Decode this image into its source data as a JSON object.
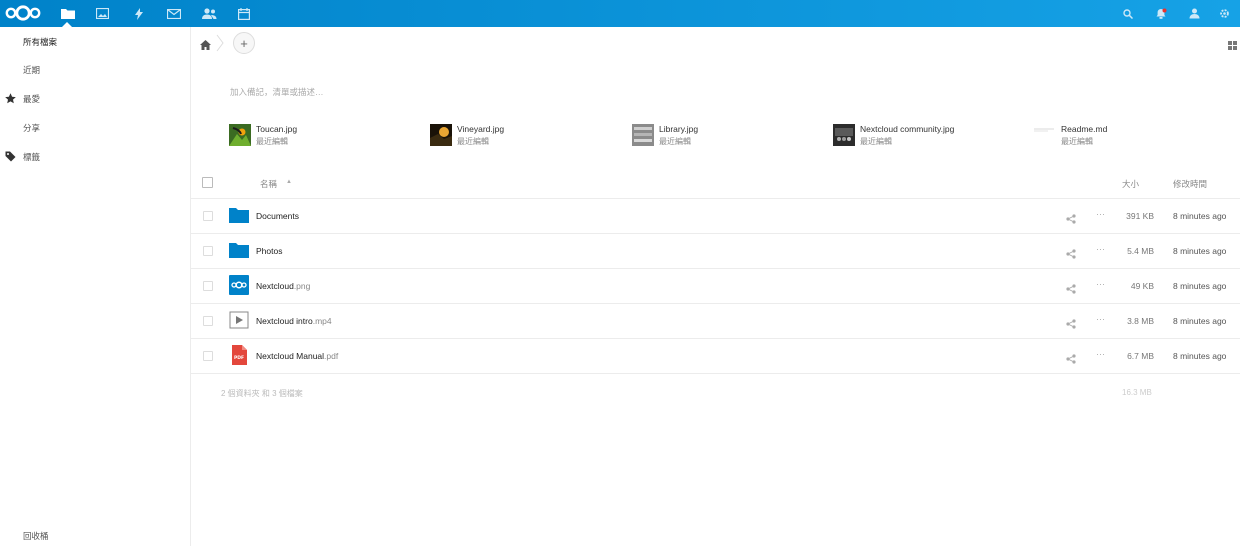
{
  "topbar": {
    "accent": "#0082c9",
    "apps": [
      {
        "name": "files-icon"
      },
      {
        "name": "photos-icon"
      },
      {
        "name": "activity-icon"
      },
      {
        "name": "mail-icon"
      },
      {
        "name": "contacts-icon"
      },
      {
        "name": "calendar-icon"
      }
    ],
    "right_icons": [
      {
        "name": "search-icon"
      },
      {
        "name": "notifications-icon"
      },
      {
        "name": "contacts-menu-icon"
      },
      {
        "name": "settings-icon"
      }
    ]
  },
  "sidebar": {
    "items": [
      {
        "label": "所有檔案"
      },
      {
        "label": "近期"
      },
      {
        "label": "最愛"
      },
      {
        "label": "分享"
      },
      {
        "label": "標籤"
      }
    ],
    "trash_label": "回收桶"
  },
  "toolbar": {
    "add_label": "+"
  },
  "note": {
    "placeholder": "加入備記，清單或描述…"
  },
  "recent_files": [
    {
      "name": "Toucan.jpg",
      "subtitle": "最近編輯"
    },
    {
      "name": "Vineyard.jpg",
      "subtitle": "最近編輯"
    },
    {
      "name": "Library.jpg",
      "subtitle": "最近編輯"
    },
    {
      "name": "Nextcloud community.jpg",
      "subtitle": "最近編輯"
    },
    {
      "name": "Readme.md",
      "subtitle": "最近編輯"
    }
  ],
  "table": {
    "headers": {
      "name": "名稱",
      "sort_indicator": "▲",
      "size": "大小",
      "modified": "修改時間"
    },
    "rows": [
      {
        "base": "Documents",
        "ext": "",
        "size": "391 KB",
        "modified": "8 minutes ago",
        "icon": "folder-icon"
      },
      {
        "base": "Photos",
        "ext": "",
        "size": "5.4 MB",
        "modified": "8 minutes ago",
        "icon": "folder-icon"
      },
      {
        "base": "Nextcloud",
        "ext": ".png",
        "size": "49 KB",
        "modified": "8 minutes ago",
        "icon": "image-file-icon"
      },
      {
        "base": "Nextcloud intro",
        "ext": ".mp4",
        "size": "3.8 MB",
        "modified": "8 minutes ago",
        "icon": "video-file-icon"
      },
      {
        "base": "Nextcloud Manual",
        "ext": ".pdf",
        "size": "6.7 MB",
        "modified": "8 minutes ago",
        "icon": "pdf-file-icon"
      }
    ],
    "more_label": "···",
    "summary": "2 個資料夾 和 3 個檔案",
    "total_size": "16.3 MB"
  }
}
